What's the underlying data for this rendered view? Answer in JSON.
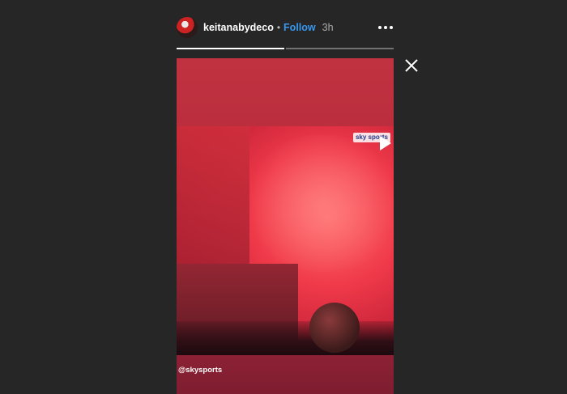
{
  "story": {
    "username": "keitanabydeco",
    "separator": "•",
    "follow_label": "Follow",
    "time": "3h",
    "caption": "@skysports",
    "video_logo": "sky sports"
  },
  "progress": [
    1,
    0
  ],
  "icons": {
    "more": "more-options-icon",
    "close": "close-icon",
    "play": "play-icon"
  },
  "colors": {
    "background": "#262626",
    "follow": "#3897f0",
    "story_bg": "#b52a3b"
  }
}
